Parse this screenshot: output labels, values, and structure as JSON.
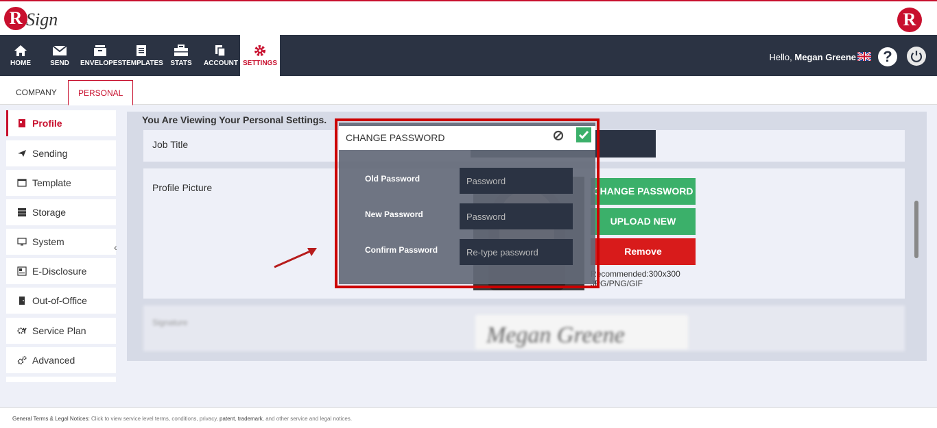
{
  "brand": {
    "logo_letter": "R",
    "logo_word": "Sign"
  },
  "nav": {
    "items": [
      {
        "label": "HOME",
        "icon": "home-icon"
      },
      {
        "label": "SEND",
        "icon": "envelope-icon"
      },
      {
        "label": "ENVELOPES",
        "icon": "inbox-icon"
      },
      {
        "label": "TEMPLATES",
        "icon": "document-icon"
      },
      {
        "label": "STATS",
        "icon": "briefcase-icon"
      },
      {
        "label": "ACCOUNT",
        "icon": "copy-icon"
      },
      {
        "label": "SETTINGS",
        "icon": "gear-icon"
      }
    ],
    "greeting": "Hello,",
    "user_name": "Megan Greene",
    "help_glyph": "?"
  },
  "subtabs": {
    "company": "COMPANY",
    "personal": "PERSONAL"
  },
  "sidebar": {
    "items": [
      {
        "label": "Profile",
        "icon": "id-card-icon"
      },
      {
        "label": "Sending",
        "icon": "paper-plane-icon"
      },
      {
        "label": "Template",
        "icon": "window-icon"
      },
      {
        "label": "Storage",
        "icon": "server-icon"
      },
      {
        "label": "System",
        "icon": "monitor-icon"
      },
      {
        "label": "E-Disclosure",
        "icon": "newspaper-icon"
      },
      {
        "label": "Out-of-Office",
        "icon": "door-icon"
      },
      {
        "label": "Service Plan",
        "icon": "gears-icon"
      },
      {
        "label": "Advanced",
        "icon": "cogs-icon"
      }
    ],
    "collapse_glyph": "‹"
  },
  "main": {
    "viewing": "You Are Viewing Your Personal Settings.",
    "job_title_label": "Job Title",
    "profile_picture_label": "Profile Picture",
    "change_password_button": "CHANGE PASSWORD",
    "upload_button": "UPLOAD NEW",
    "remove_button": "Remove",
    "recommended_line1": "Recommended:300x300",
    "recommended_line2": "JPG/PNG/GIF",
    "signature_label": "Signature",
    "signature_text": "Megan Greene"
  },
  "dialog": {
    "title": "CHANGE PASSWORD",
    "old_label": "Old Password",
    "new_label": "New Password",
    "confirm_label": "Confirm Password",
    "old_placeholder": "Password",
    "new_placeholder": "Password",
    "confirm_placeholder": "Re-type password"
  },
  "footer": {
    "prefix": "General Terms & Legal Notices:",
    "text1": " Click to view service level terms, conditions, privacy, ",
    "patent": "patent",
    "comma": ", ",
    "trademark": "trademark",
    "text2": ", and other service and legal notices."
  },
  "colors": {
    "accent": "#c8102e",
    "nav_bg": "#2b3343",
    "green": "#3bb06a",
    "red": "#d81b1b"
  }
}
